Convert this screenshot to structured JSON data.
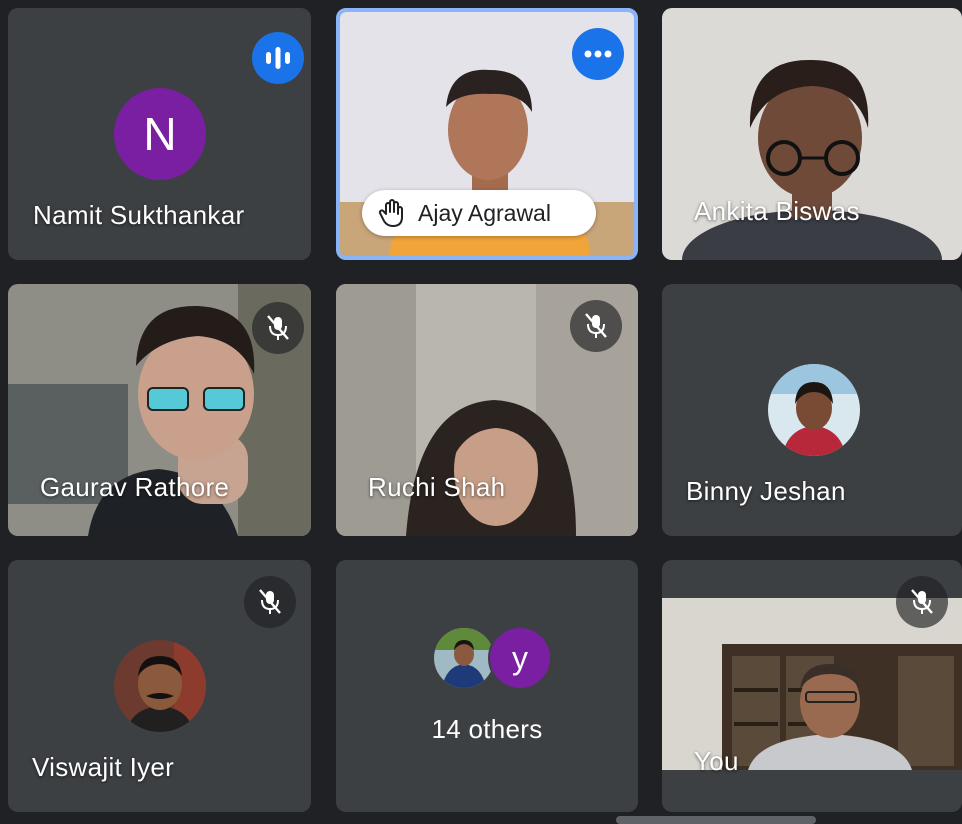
{
  "participants": [
    {
      "name": "Namit Sukthankar",
      "initial": "N",
      "avatar_color": "#7b1fa2",
      "status": "speaking"
    },
    {
      "name": "Ajay Agrawal",
      "status": "hand-raised",
      "menu_icon": "more-options-icon",
      "hand_icon": "raised-hand-icon"
    },
    {
      "name": "Ankita Biswas"
    },
    {
      "name": "Gaurav Rathore",
      "muted": true
    },
    {
      "name": "Ruchi Shah",
      "muted": true
    },
    {
      "name": "Binny Jeshan"
    },
    {
      "name": "Viswajit Iyer",
      "muted": true
    },
    {
      "others_label": "14 others",
      "avatar_initial": "y",
      "avatar_color": "#7b1fa2"
    },
    {
      "name": "You",
      "muted": true
    }
  ],
  "colors": {
    "background": "#202124",
    "tile": "#3c4043",
    "active_border": "#8ab4f8",
    "speaking_badge": "#1a73e8"
  },
  "icons": [
    "speaking-indicator-icon",
    "more-options-icon",
    "raised-hand-icon",
    "mic-off-icon"
  ]
}
